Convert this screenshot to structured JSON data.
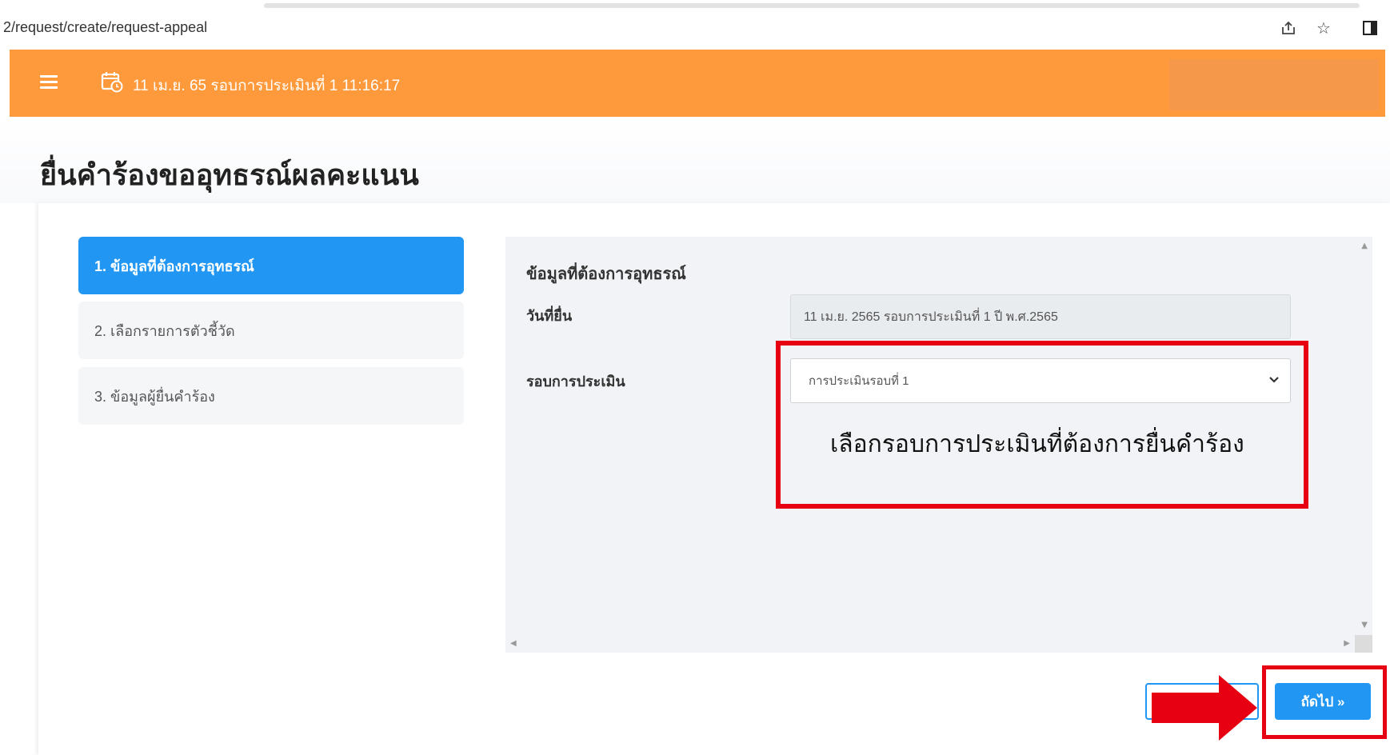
{
  "browser": {
    "url": "2/request/create/request-appeal"
  },
  "header": {
    "date_text": "11 เม.ย. 65  รอบการประเมินที่ 1  11:16:17"
  },
  "page": {
    "title": "ยื่นคำร้องขออุทธรณ์ผลคะแนน"
  },
  "steps": [
    {
      "label": "1. ข้อมูลที่ต้องการอุทธรณ์",
      "active": true
    },
    {
      "label": "2. เลือกรายการตัวชี้วัด",
      "active": false
    },
    {
      "label": "3. ข้อมูลผู้ยื่นคำร้อง",
      "active": false
    }
  ],
  "form": {
    "heading": "ข้อมูลที่ต้องการอุทธรณ์",
    "date_label": "วันที่ยื่น",
    "date_value": "11 เม.ย. 2565 รอบการประเมินที่ 1 ปี พ.ศ.2565",
    "round_label": "รอบการประเมิน",
    "round_selected": "การประเมินรอบที่ 1"
  },
  "annotation": {
    "text": "เลือกรอบการประเมินที่ต้องการยื่นคำร้อง"
  },
  "buttons": {
    "next_label": "ถัดไป »"
  },
  "colors": {
    "header": "#ff9a3c",
    "primary": "#2196f3",
    "annotation_red": "#e60012"
  }
}
